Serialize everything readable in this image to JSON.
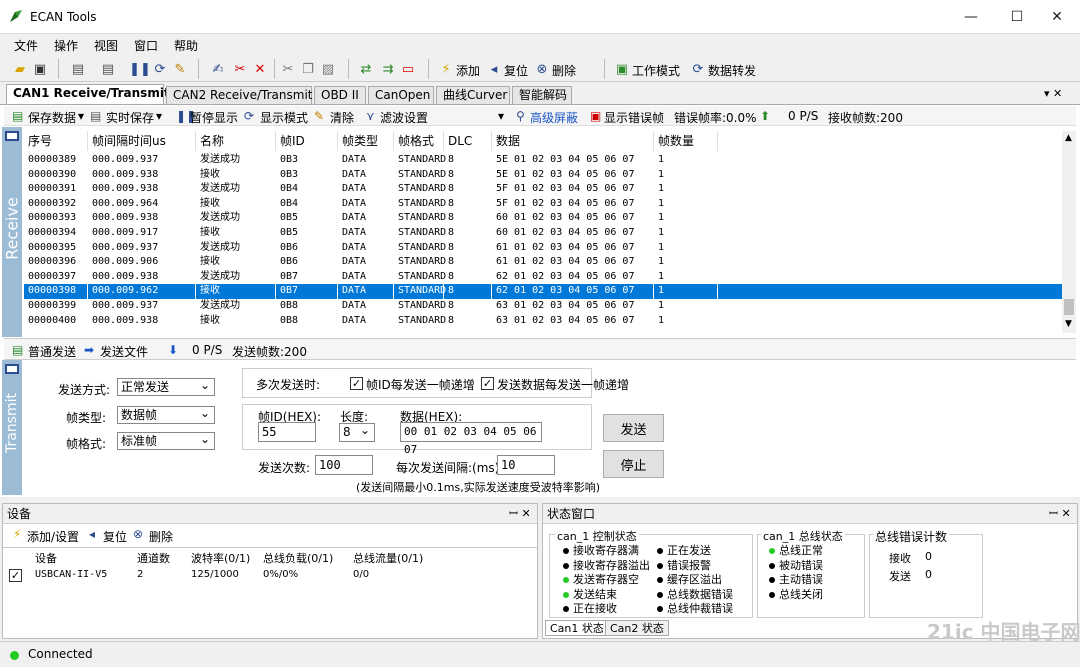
{
  "window": {
    "title": "ECAN Tools",
    "minimize": "—",
    "maximize": "☐",
    "close": "✕"
  },
  "menu": [
    "文件",
    "操作",
    "视图",
    "窗口",
    "帮助"
  ],
  "toolbar": {
    "add": "添加",
    "reset": "复位",
    "delete": "删除",
    "work_mode": "工作模式",
    "data_forward": "数据转发"
  },
  "tabs": [
    "CAN1 Receive/Transmit",
    "CAN2 Receive/Transmit",
    "OBD II",
    "CanOpen",
    "曲线Curver",
    "智能解码"
  ],
  "tab_close": "▾ ✕",
  "receive": {
    "side_label": "Receive",
    "save_data": "保存数据",
    "realtime_save": "实时保存",
    "pause_display": "暂停显示",
    "display_mode": "显示模式",
    "clear": "清除",
    "filter": "滤波设置",
    "advanced_mask": "高级屏蔽",
    "show_error": "显示错误帧",
    "error_rate": "错误帧率:0.0%",
    "rate": "0 P/S",
    "recv_count": "接收帧数:200",
    "columns": [
      "序号",
      "帧间隔时间us",
      "名称",
      "帧ID",
      "帧类型",
      "帧格式",
      "DLC",
      "数据",
      "帧数量"
    ],
    "rows": [
      [
        "00000389",
        "000.009.937",
        "发送成功",
        "0B3",
        "DATA",
        "STANDARD",
        "8",
        "5E 01 02 03 04 05 06 07",
        "1"
      ],
      [
        "00000390",
        "000.009.938",
        "接收",
        "0B3",
        "DATA",
        "STANDARD",
        "8",
        "5E 01 02 03 04 05 06 07",
        "1"
      ],
      [
        "00000391",
        "000.009.938",
        "发送成功",
        "0B4",
        "DATA",
        "STANDARD",
        "8",
        "5F 01 02 03 04 05 06 07",
        "1"
      ],
      [
        "00000392",
        "000.009.964",
        "接收",
        "0B4",
        "DATA",
        "STANDARD",
        "8",
        "5F 01 02 03 04 05 06 07",
        "1"
      ],
      [
        "00000393",
        "000.009.938",
        "发送成功",
        "0B5",
        "DATA",
        "STANDARD",
        "8",
        "60 01 02 03 04 05 06 07",
        "1"
      ],
      [
        "00000394",
        "000.009.917",
        "接收",
        "0B5",
        "DATA",
        "STANDARD",
        "8",
        "60 01 02 03 04 05 06 07",
        "1"
      ],
      [
        "00000395",
        "000.009.937",
        "发送成功",
        "0B6",
        "DATA",
        "STANDARD",
        "8",
        "61 01 02 03 04 05 06 07",
        "1"
      ],
      [
        "00000396",
        "000.009.906",
        "接收",
        "0B6",
        "DATA",
        "STANDARD",
        "8",
        "61 01 02 03 04 05 06 07",
        "1"
      ],
      [
        "00000397",
        "000.009.938",
        "发送成功",
        "0B7",
        "DATA",
        "STANDARD",
        "8",
        "62 01 02 03 04 05 06 07",
        "1"
      ],
      [
        "00000398",
        "000.009.962",
        "接收",
        "0B7",
        "DATA",
        "STANDARD",
        "8",
        "62 01 02 03 04 05 06 07",
        "1"
      ],
      [
        "00000399",
        "000.009.937",
        "发送成功",
        "0B8",
        "DATA",
        "STANDARD",
        "8",
        "63 01 02 03 04 05 06 07",
        "1"
      ],
      [
        "00000400",
        "000.009.938",
        "接收",
        "0B8",
        "DATA",
        "STANDARD",
        "8",
        "63 01 02 03 04 05 06 07",
        "1"
      ]
    ],
    "selected_row": 9
  },
  "transmit": {
    "side_label": "Transmit",
    "normal_send": "普通发送",
    "send_file": "发送文件",
    "rate": "0 P/S",
    "send_count": "发送帧数:200",
    "send_mode_label": "发送方式:",
    "send_mode_value": "正常发送",
    "frame_type_label": "帧类型:",
    "frame_type_value": "数据帧",
    "frame_format_label": "帧格式:",
    "frame_format_value": "标准帧",
    "multi_label": "多次发送时:",
    "inc_id": "帧ID每发送一帧递增",
    "inc_data": "发送数据每发送一帧递增",
    "frame_id_label": "帧ID(HEX):",
    "frame_id_value": "55",
    "length_label": "长度:",
    "length_value": "8",
    "data_label": "数据(HEX):",
    "data_value": "00 01 02 03 04 05 06 07",
    "send_times_label": "发送次数:",
    "send_times_value": "100",
    "interval_label": "每次发送间隔:(ms)",
    "interval_value": "10",
    "note": "(发送间隔最小0.1ms,实际发送速度受波特率影响)",
    "send_btn": "发送",
    "stop_btn": "停止"
  },
  "device": {
    "title": "设备",
    "pin": "ꟷ ✕",
    "add_setting": "添加/设置",
    "reset": "复位",
    "delete": "删除",
    "columns": [
      "设备",
      "通道数",
      "波特率(0/1)",
      "总线负载(0/1)",
      "总线流量(0/1)"
    ],
    "row": [
      "USBCAN-II-V5",
      "2",
      "125/1000",
      "0%/0%",
      "0/0"
    ]
  },
  "status": {
    "title": "状态窗口",
    "ctrl_title": "can_1 控制状态",
    "ctrl_col1": [
      {
        "t": "接收寄存器满",
        "c": "#000000"
      },
      {
        "t": "接收寄存器溢出",
        "c": "#000000"
      },
      {
        "t": "发送寄存器空",
        "c": "#22cc22"
      },
      {
        "t": "发送结束",
        "c": "#22cc22"
      },
      {
        "t": "正在接收",
        "c": "#000000"
      }
    ],
    "ctrl_col2": [
      {
        "t": "正在发送",
        "c": "#000000"
      },
      {
        "t": "错误报警",
        "c": "#000000"
      },
      {
        "t": "缓存区溢出",
        "c": "#000000"
      },
      {
        "t": "总线数据错误",
        "c": "#000000"
      },
      {
        "t": "总线仲裁错误",
        "c": "#000000"
      }
    ],
    "bus_title": "can_1 总线状态",
    "bus": [
      {
        "t": "总线正常",
        "c": "#22cc22"
      },
      {
        "t": "被动错误",
        "c": "#000000"
      },
      {
        "t": "主动错误",
        "c": "#000000"
      },
      {
        "t": "总线关闭",
        "c": "#000000"
      }
    ],
    "err_title": "总线错误计数",
    "recv_label": "接收",
    "recv_value": "0",
    "send_label": "发送",
    "send_value": "0",
    "tab1": "Can1 状态",
    "tab2": "Can2 状态"
  },
  "statusbar": {
    "text": "Connected"
  },
  "watermark": "21ic 中国电子网"
}
